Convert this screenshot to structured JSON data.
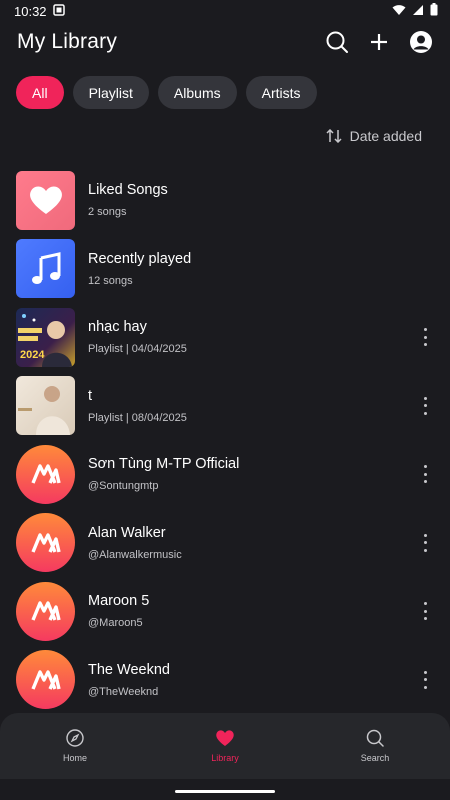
{
  "status": {
    "time": "10:32"
  },
  "header": {
    "title": "My Library"
  },
  "chips": [
    {
      "label": "All"
    },
    {
      "label": "Playlist"
    },
    {
      "label": "Albums"
    },
    {
      "label": "Artists"
    }
  ],
  "sort": {
    "label": "Date added"
  },
  "items": [
    {
      "title": "Liked Songs",
      "sub": "2 songs"
    },
    {
      "title": "Recently played",
      "sub": "12 songs"
    },
    {
      "title": "nhạc hay",
      "sub": "Playlist | 04/04/2025",
      "cover_text": "2024"
    },
    {
      "title": "t",
      "sub": "Playlist | 08/04/2025"
    },
    {
      "title": "Sơn Tùng M-TP Official",
      "sub": "@Sontungmtp"
    },
    {
      "title": "Alan Walker",
      "sub": "@Alanwalkermusic"
    },
    {
      "title": "Maroon 5",
      "sub": "@Maroon5"
    },
    {
      "title": "The Weeknd",
      "sub": "@TheWeeknd"
    }
  ],
  "nav": [
    {
      "label": "Home",
      "icon": "compass-icon"
    },
    {
      "label": "Library",
      "icon": "heart-icon"
    },
    {
      "label": "Search",
      "icon": "search-icon"
    }
  ],
  "colors": {
    "accent": "#f0245a",
    "background": "#1b1b1f",
    "chip": "#34353b"
  }
}
